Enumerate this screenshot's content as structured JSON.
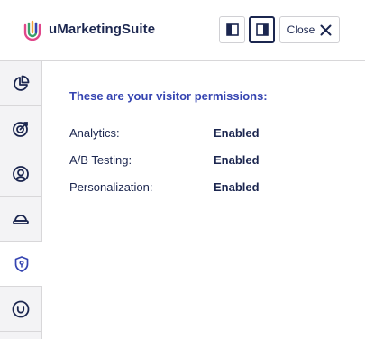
{
  "header": {
    "app_title": "uMarketingSuite",
    "close_label": "Close",
    "logo_colors": [
      "#e0478a",
      "#f2a23a",
      "#3aa06b",
      "#3544b1"
    ]
  },
  "sidebar": {
    "items": [
      {
        "icon": "pie-chart-icon",
        "active": false
      },
      {
        "icon": "target-icon",
        "active": false
      },
      {
        "icon": "user-profile-icon",
        "active": false
      },
      {
        "icon": "hat-icon",
        "active": false
      },
      {
        "icon": "shield-icon",
        "active": true
      },
      {
        "icon": "umbraco-logo-icon",
        "active": false
      }
    ]
  },
  "main": {
    "title": "These are your visitor permissions:",
    "permissions": [
      {
        "label": "Analytics:",
        "value": "Enabled"
      },
      {
        "label": "A/B Testing:",
        "value": "Enabled"
      },
      {
        "label": "Personalization:",
        "value": "Enabled"
      }
    ]
  },
  "colors": {
    "title_accent": "#3544b1",
    "text": "#1b264f",
    "sidebar_bg": "#f3f3f5"
  }
}
